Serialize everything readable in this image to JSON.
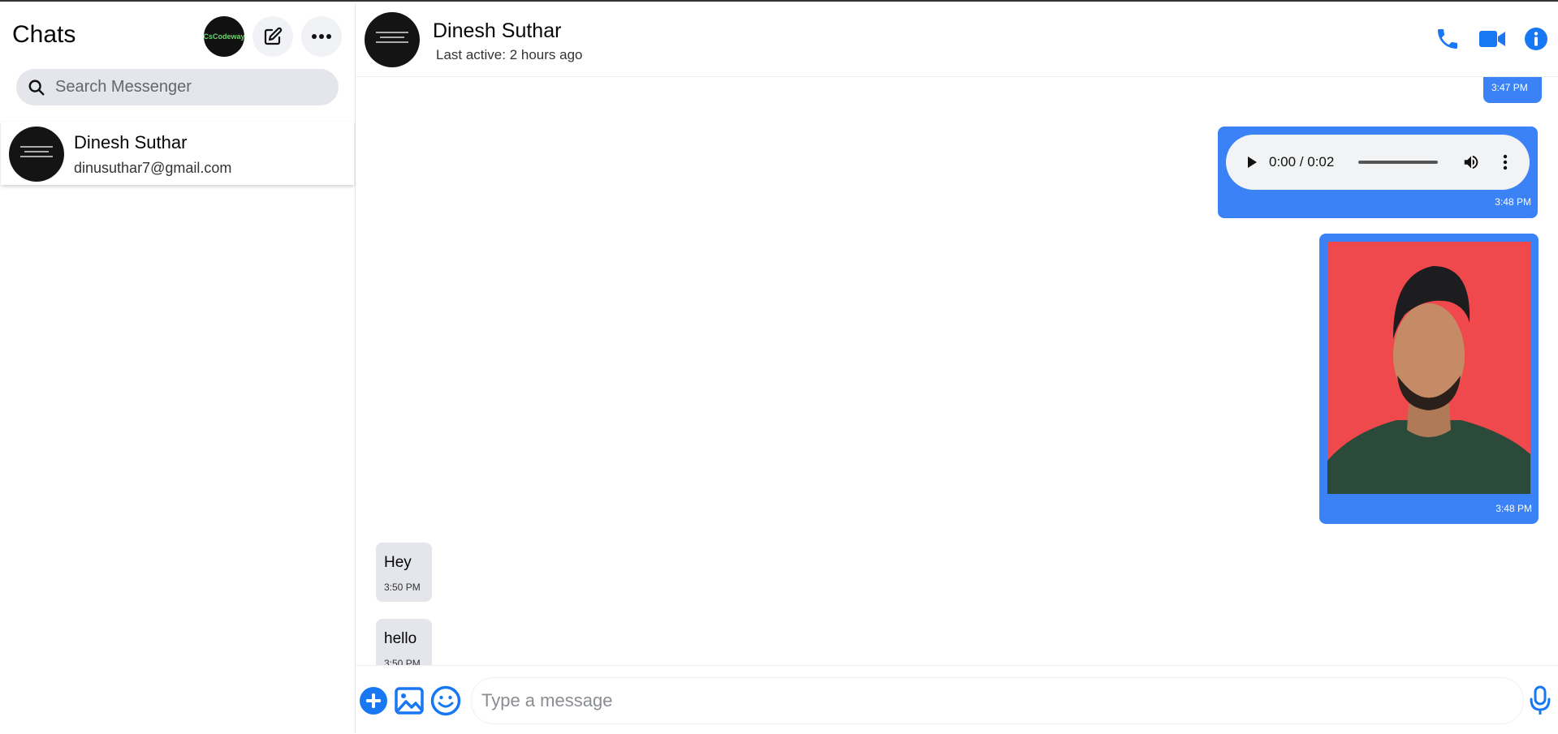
{
  "sidebar": {
    "title": "Chats",
    "my_avatar_text": "CsCodeway",
    "search_placeholder": "Search Messenger",
    "contacts": [
      {
        "name": "Dinesh Suthar",
        "email": "dinusuthar7@gmail.com"
      }
    ]
  },
  "chat": {
    "name": "Dinesh Suthar",
    "status": "Last active: 2 hours ago"
  },
  "messages": [
    {
      "direction": "out",
      "type": "text",
      "time": "3:47 PM"
    },
    {
      "direction": "out",
      "type": "audio",
      "audio_time": "0:00 / 0:02",
      "time": "3:48 PM"
    },
    {
      "direction": "out",
      "type": "image",
      "time": "3:48 PM"
    },
    {
      "direction": "in",
      "type": "text",
      "text": "Hey",
      "time": "3:50 PM"
    },
    {
      "direction": "in",
      "type": "text",
      "text": "hello",
      "time": "3:50 PM"
    }
  ],
  "composer": {
    "placeholder": "Type a message"
  },
  "colors": {
    "accent": "#3b82f6",
    "incoming_bubble": "#e4e6eb",
    "icon_blue": "#1877f2"
  },
  "icons": [
    "compose-icon",
    "more-icon",
    "search-icon",
    "phone-icon",
    "video-icon",
    "info-icon",
    "play-icon",
    "volume-icon",
    "kebab-icon",
    "add-icon",
    "image-icon",
    "emoji-icon",
    "mic-icon"
  ]
}
